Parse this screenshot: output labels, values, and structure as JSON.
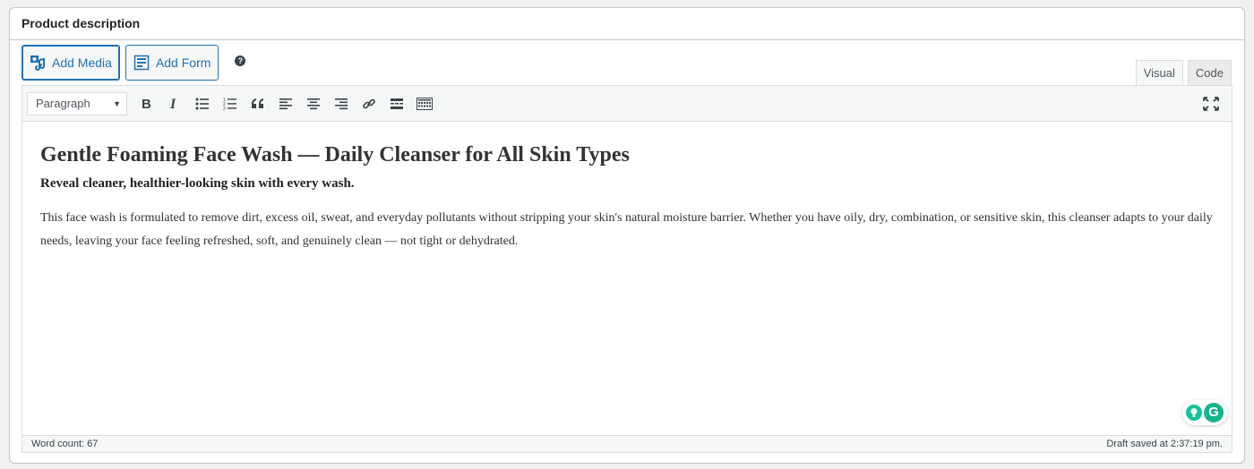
{
  "box": {
    "title": "Product description"
  },
  "media_buttons": {
    "add_media": "Add Media",
    "add_form": "Add Form",
    "help": "?"
  },
  "tabs": [
    {
      "label": "Visual",
      "active": true
    },
    {
      "label": "Code",
      "active": false
    }
  ],
  "toolbar": {
    "format_value": "Paragraph",
    "buttons": [
      "bold-icon",
      "italic-icon",
      "bulleted-list-icon",
      "numbered-list-icon",
      "blockquote-icon",
      "align-left-icon",
      "align-center-icon",
      "align-right-icon",
      "link-icon",
      "read-more-icon",
      "toolbar-toggle-icon"
    ],
    "fullscreen": "fullscreen-icon"
  },
  "content": {
    "heading": "Gentle Foaming Face Wash — Daily Cleanser for All Skin Types",
    "tagline": "Reveal cleaner, healthier-looking skin with every wash.",
    "paragraph": "This face wash is formulated to remove dirt, excess oil, sweat, and everyday pollutants without stripping your skin's natural moisture barrier. Whether you have oily, dry, combination, or sensitive skin, this cleanser adapts to your daily needs, leaving your face feeling refreshed, soft, and genuinely clean — not tight or dehydrated."
  },
  "status": {
    "word_count": "Word count: 67",
    "draft_saved": "Draft saved at 2:37:19 pm."
  },
  "colors": {
    "accent": "#2271b1",
    "grammarly": "#15c39a"
  }
}
